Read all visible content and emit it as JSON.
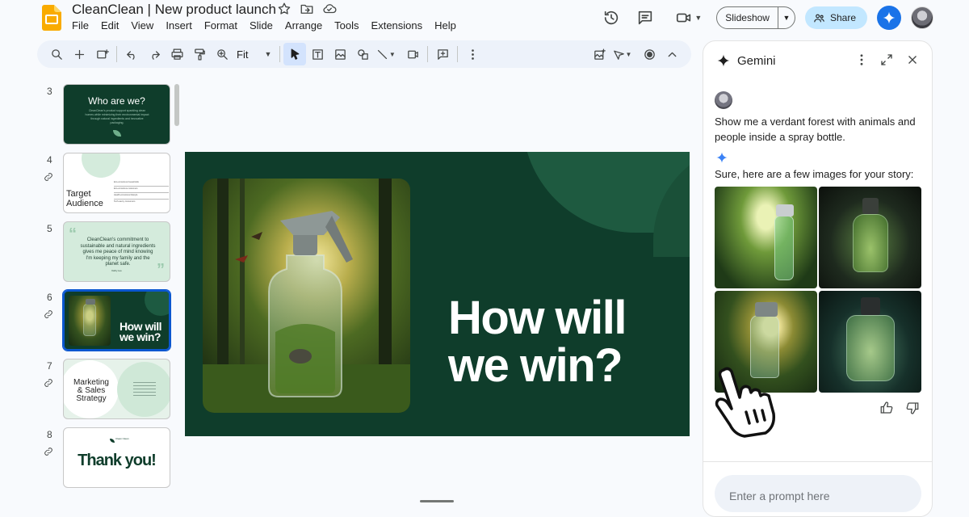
{
  "app": {
    "doc_title": "CleanClean | New product launch",
    "menu": [
      "File",
      "Edit",
      "View",
      "Insert",
      "Format",
      "Slide",
      "Arrange",
      "Tools",
      "Extensions",
      "Help"
    ],
    "slideshow_label": "Slideshow",
    "share_label": "Share"
  },
  "toolbar": {
    "zoom_value": "Fit",
    "icons": [
      "search-icon",
      "zoom-in-icon",
      "new-slide-icon",
      "undo-icon",
      "redo-icon",
      "print-icon",
      "paint-format-icon",
      "zoom-icon",
      "select-icon",
      "text-box-icon",
      "image-icon",
      "shape-icon",
      "line-icon",
      "video-icon",
      "comment-icon",
      "more-icon",
      "background-icon",
      "transition-icon",
      "record-icon",
      "collapse-icon"
    ]
  },
  "filmstrip": {
    "slides": [
      {
        "num": "3",
        "title": "Who are we?",
        "body": "CleanClean's product support sparkling clean homes while minimizing their environmental impact through natural ingredients and innovative packaging."
      },
      {
        "num": "4",
        "title": "Target Audience",
        "rows": [
          "Eco-conscious households",
          "Eco-conscious customers",
          "Health-conscious lifestyle",
          "Tech-savvy consumers"
        ]
      },
      {
        "num": "5",
        "quote": "CleanClean's commitment to sustainable and natural ingredients gives me peace of mind knowing I'm keeping my family and the planet safe.",
        "attribution": "Kathy Lee"
      },
      {
        "num": "6",
        "title": "How will we win?"
      },
      {
        "num": "7",
        "title": "Marketing & Sales Strategy"
      },
      {
        "num": "8",
        "brand": "Clean Clean",
        "title": "Thank you!"
      }
    ]
  },
  "slide": {
    "heading_line1": "How will",
    "heading_line2": "we win?"
  },
  "gemini": {
    "title": "Gemini",
    "user_message": "Show me a verdant forest with animals and people inside a spray bottle.",
    "response": "Sure, here are a few images for your story:",
    "prompt_placeholder": "Enter a prompt here"
  },
  "colors": {
    "slide_bg": "#0f3d2b",
    "accent_blue": "#0b57d0",
    "share_bg": "#c2e7ff"
  }
}
